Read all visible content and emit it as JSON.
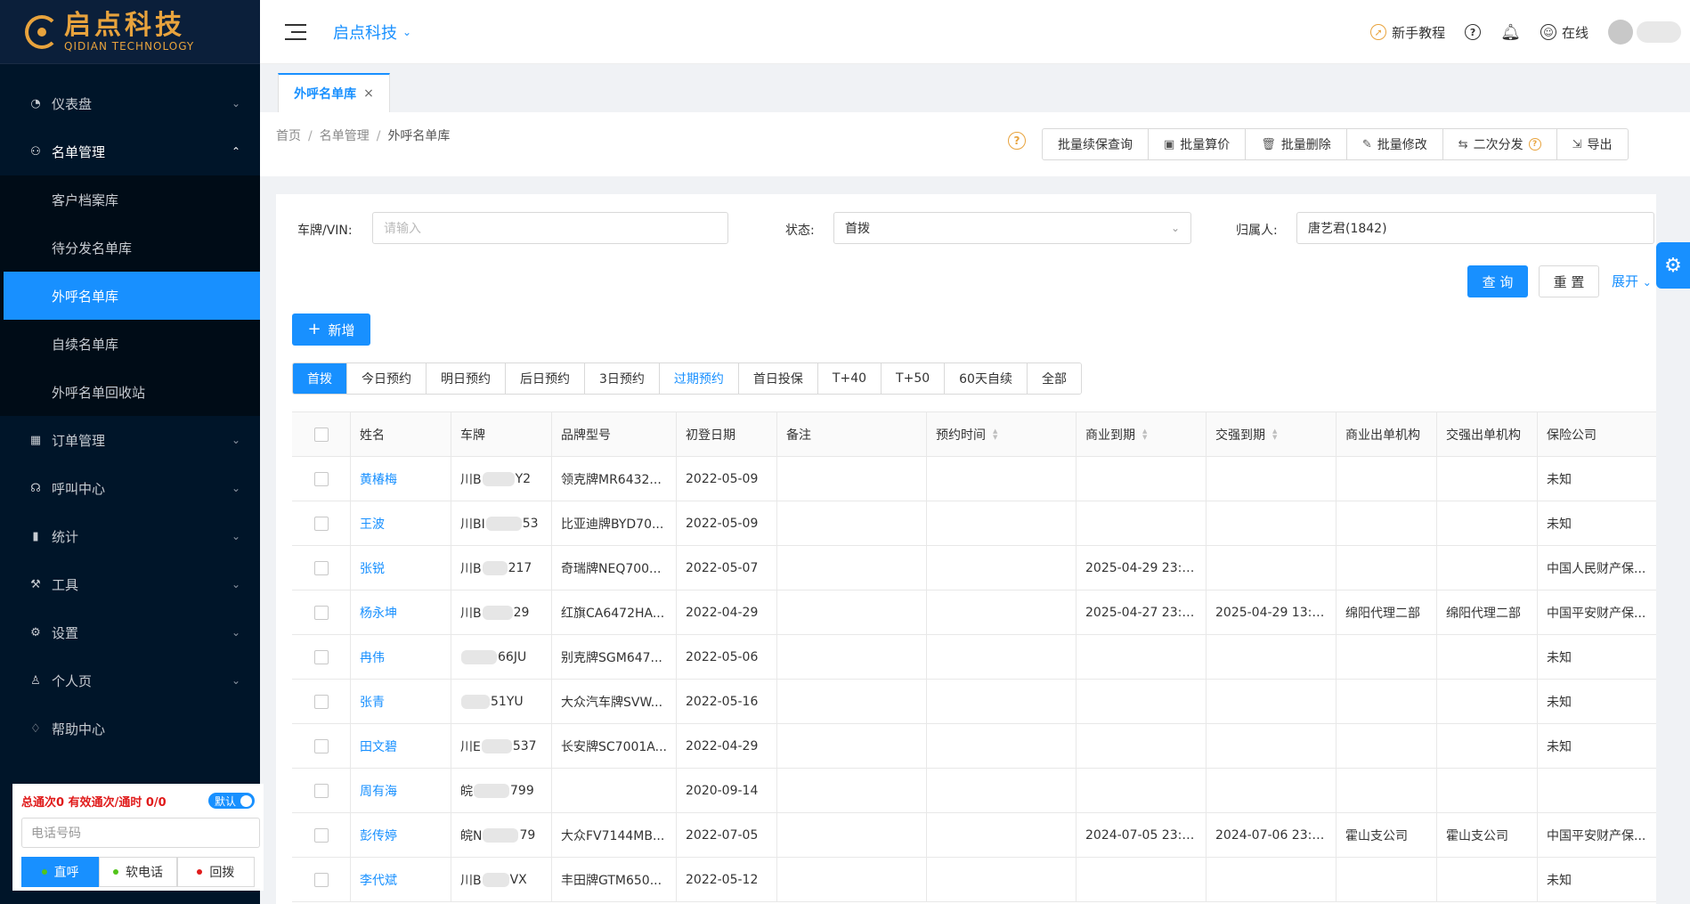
{
  "sidebar": {
    "logo_cn": "启点科技",
    "logo_en": "QIDIAN TECHNOLOGY",
    "menu": [
      {
        "label": "仪表盘",
        "icon": "dashboard-icon"
      },
      {
        "label": "名单管理",
        "icon": "user-list-icon"
      },
      {
        "label": "订单管理",
        "icon": "calendar-icon"
      },
      {
        "label": "呼叫中心",
        "icon": "headset-icon"
      },
      {
        "label": "统计",
        "icon": "bar-chart-icon"
      },
      {
        "label": "工具",
        "icon": "wrench-icon"
      },
      {
        "label": "设置",
        "icon": "gear-icon"
      },
      {
        "label": "个人页",
        "icon": "person-icon"
      },
      {
        "label": "帮助中心",
        "icon": "lightbulb-icon"
      }
    ],
    "submenu": [
      "客户档案库",
      "待分发名单库",
      "外呼名单库",
      "自续名单库",
      "外呼名单回收站"
    ]
  },
  "phone": {
    "stats": "总通次0 有效通次/通时 0/0",
    "toggle_label": "默认",
    "placeholder": "电话号码",
    "btn_direct": "直呼",
    "btn_soft": "软电话",
    "btn_callback": "回拨"
  },
  "header": {
    "company": "启点科技",
    "tutorial": "新手教程",
    "online": "在线"
  },
  "tabbar": {
    "tab_label": "外呼名单库"
  },
  "breadcrumb": {
    "home": "首页",
    "level2": "名单管理",
    "current": "外呼名单库"
  },
  "batch": {
    "renew_query": "批量续保查询",
    "calc": "批量算价",
    "delete": "批量删除",
    "modify": "批量修改",
    "redistribute": "二次分发",
    "export": "导出"
  },
  "filters": {
    "plate_label": "车牌/VIN:",
    "plate_placeholder": "请输入",
    "status_label": "状态:",
    "status_value": "首拨",
    "owner_label": "归属人:",
    "owner_value": "唐艺君(1842)",
    "query_btn": "查 询",
    "reset_btn": "重 置",
    "expand": "展开"
  },
  "add_btn": "新增",
  "status_tabs": [
    "首拨",
    "今日预约",
    "明日预约",
    "后日预约",
    "3日预约",
    "过期预约",
    "首日投保",
    "T+40",
    "T+50",
    "60天自续",
    "全部"
  ],
  "table": {
    "headers": [
      "姓名",
      "车牌",
      "品牌型号",
      "初登日期",
      "备注",
      "预约时间",
      "商业到期",
      "交强到期",
      "商业出单机构",
      "交强出单机构",
      "保险公司"
    ],
    "rows": [
      {
        "name": "黄椿梅",
        "plate_a": "川B",
        "plate_b": "Y2",
        "brand": "领克牌MR6432...",
        "date": "2022-05-09",
        "note": "",
        "appt": "",
        "biz_exp": "",
        "tci_exp": "",
        "biz_org": "",
        "tci_org": "",
        "insurer": "未知"
      },
      {
        "name": "王波",
        "plate_a": "川BI",
        "plate_b": "53",
        "brand": "比亚迪牌BYD70...",
        "date": "2022-05-09",
        "note": "",
        "appt": "",
        "biz_exp": "",
        "tci_exp": "",
        "biz_org": "",
        "tci_org": "",
        "insurer": "未知"
      },
      {
        "name": "张锐",
        "plate_a": "川B",
        "plate_b": "217",
        "brand": "奇瑞牌NEQ700...",
        "date": "2022-05-07",
        "note": "",
        "appt": "",
        "biz_exp": "2025-04-29 23:5...",
        "tci_exp": "",
        "biz_org": "",
        "tci_org": "",
        "insurer": "中国人民财产保..."
      },
      {
        "name": "杨永坤",
        "plate_a": "川B",
        "plate_b": "29",
        "brand": "红旗CA6472HA...",
        "date": "2022-04-29",
        "note": "",
        "appt": "",
        "biz_exp": "2025-04-27 23:2...",
        "tci_exp": "2025-04-29 13:2...",
        "biz_org": "绵阳代理二部",
        "tci_org": "绵阳代理二部",
        "insurer": "中国平安财产保..."
      },
      {
        "name": "冉伟",
        "plate_a": "",
        "plate_b": "66JU",
        "brand": "别克牌SGM647...",
        "date": "2022-05-06",
        "note": "",
        "appt": "",
        "biz_exp": "",
        "tci_exp": "",
        "biz_org": "",
        "tci_org": "",
        "insurer": "未知"
      },
      {
        "name": "张青",
        "plate_a": "",
        "plate_b": "51YU",
        "brand": "大众汽车牌SVW...",
        "date": "2022-05-16",
        "note": "",
        "appt": "",
        "biz_exp": "",
        "tci_exp": "",
        "biz_org": "",
        "tci_org": "",
        "insurer": "未知"
      },
      {
        "name": "田文碧",
        "plate_a": "川E",
        "plate_b": "537",
        "brand": "长安牌SC7001A...",
        "date": "2022-04-29",
        "note": "",
        "appt": "",
        "biz_exp": "",
        "tci_exp": "",
        "biz_org": "",
        "tci_org": "",
        "insurer": "未知"
      },
      {
        "name": "周有海",
        "plate_a": "皖",
        "plate_b": "799",
        "brand": "",
        "date": "2020-09-14",
        "note": "",
        "appt": "",
        "biz_exp": "",
        "tci_exp": "",
        "biz_org": "",
        "tci_org": "",
        "insurer": ""
      },
      {
        "name": "彭传婷",
        "plate_a": "皖N",
        "plate_b": "79",
        "brand": "大众FV7144MB...",
        "date": "2022-07-05",
        "note": "",
        "appt": "",
        "biz_exp": "2024-07-05 23:5...",
        "tci_exp": "2024-07-06 23:5...",
        "biz_org": "霍山支公司",
        "tci_org": "霍山支公司",
        "insurer": "中国平安财产保..."
      },
      {
        "name": "李代斌",
        "plate_a": "川B",
        "plate_b": "VX",
        "brand": "丰田牌GTM650...",
        "date": "2022-05-12",
        "note": "",
        "appt": "",
        "biz_exp": "",
        "tci_exp": "",
        "biz_org": "",
        "tci_org": "",
        "insurer": "未知"
      }
    ]
  }
}
